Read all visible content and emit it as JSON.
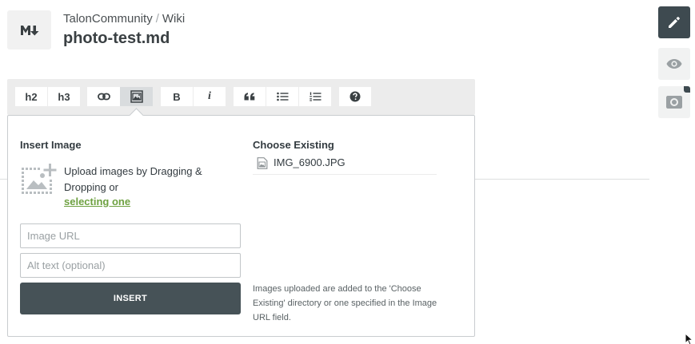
{
  "header": {
    "logo_icon": "markdown-icon",
    "breadcrumb": {
      "community": "TalonCommunity",
      "separator": "/",
      "section": "Wiki"
    },
    "file_title": "photo-test.md"
  },
  "sidebar": {
    "edit_icon": "pencil-icon",
    "preview_icon": "eye-icon",
    "attachments_icon": "camera-icon"
  },
  "toolbar": {
    "h2": "h2",
    "h3": "h3",
    "link_icon": "link-icon",
    "image_icon": "image-icon",
    "bold": "B",
    "italic": "i",
    "quote_icon": "quote-icon",
    "bullet_list_icon": "bullet-list-icon",
    "numbered_list_icon": "numbered-list-icon",
    "help_icon": "help-icon"
  },
  "image_panel": {
    "insert_title": "Insert Image",
    "upload_text": "Upload images by Dragging & Dropping or",
    "upload_link": "selecting one",
    "url_placeholder": "Image URL",
    "alt_placeholder": "Alt text (optional)",
    "insert_button": "INSERT",
    "existing_title": "Choose Existing",
    "existing_files": [
      "IMG_6900.JPG"
    ],
    "note": "Images uploaded are added to the 'Choose Existing' directory or one specified in the Image URL field."
  },
  "colors": {
    "accent_dark": "#3e4a50",
    "link_green": "#6ea141",
    "toolbar_bg": "#ececec"
  }
}
